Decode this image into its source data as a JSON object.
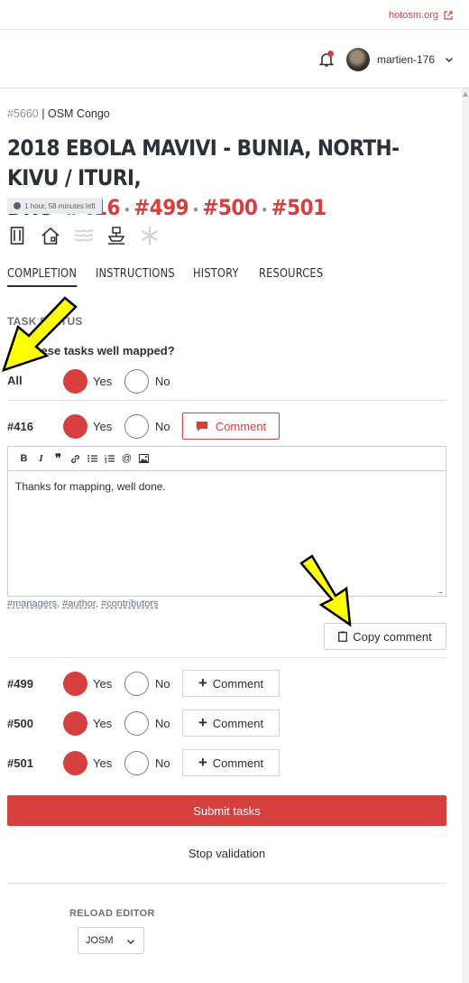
{
  "header": {
    "site_link": "hotosm.org",
    "username": "martien-176"
  },
  "breadcrumb": {
    "project_id": "#5660",
    "separator": " | ",
    "organisation": "OSM Congo"
  },
  "project": {
    "title": "2018 EBOLA MAVIVI - BUNIA, NORTH-KIVU / ITURI, DRC",
    "tasks": [
      "#416",
      "#499",
      "#500",
      "#501"
    ],
    "time_left": "1 hour, 58 minutes left"
  },
  "tabs": [
    "COMPLETION",
    "INSTRUCTIONS",
    "HISTORY",
    "RESOURCES"
  ],
  "task_status": {
    "heading": "TASK STATUS",
    "question": "Are these tasks well mapped?",
    "all_label": "All",
    "yes_label": "Yes",
    "no_label": "No",
    "comment_label": "Comment",
    "rows": [
      {
        "task": "#416",
        "selected": "Yes",
        "comment_open": true
      },
      {
        "task": "#499",
        "selected": "Yes",
        "comment_open": false
      },
      {
        "task": "#500",
        "selected": "Yes",
        "comment_open": false
      },
      {
        "task": "#501",
        "selected": "Yes",
        "comment_open": false
      }
    ]
  },
  "editor": {
    "text": "Thanks for mapping, well done.",
    "toolbar": [
      "B",
      "I",
      "99",
      "link",
      "ul",
      "ol",
      "@",
      "image"
    ],
    "mentions": [
      "#managers",
      "#author",
      "#contributors"
    ],
    "copy_label": "Copy comment"
  },
  "actions": {
    "submit_label": "Submit tasks",
    "stop_label": "Stop validation"
  },
  "reload": {
    "heading": "RELOAD EDITOR",
    "selected": "JOSM"
  },
  "colors": {
    "accent": "#d73f3f",
    "text": "#2c3038",
    "muted": "#8a94a6",
    "highlight_arrow": "#ffff00"
  }
}
